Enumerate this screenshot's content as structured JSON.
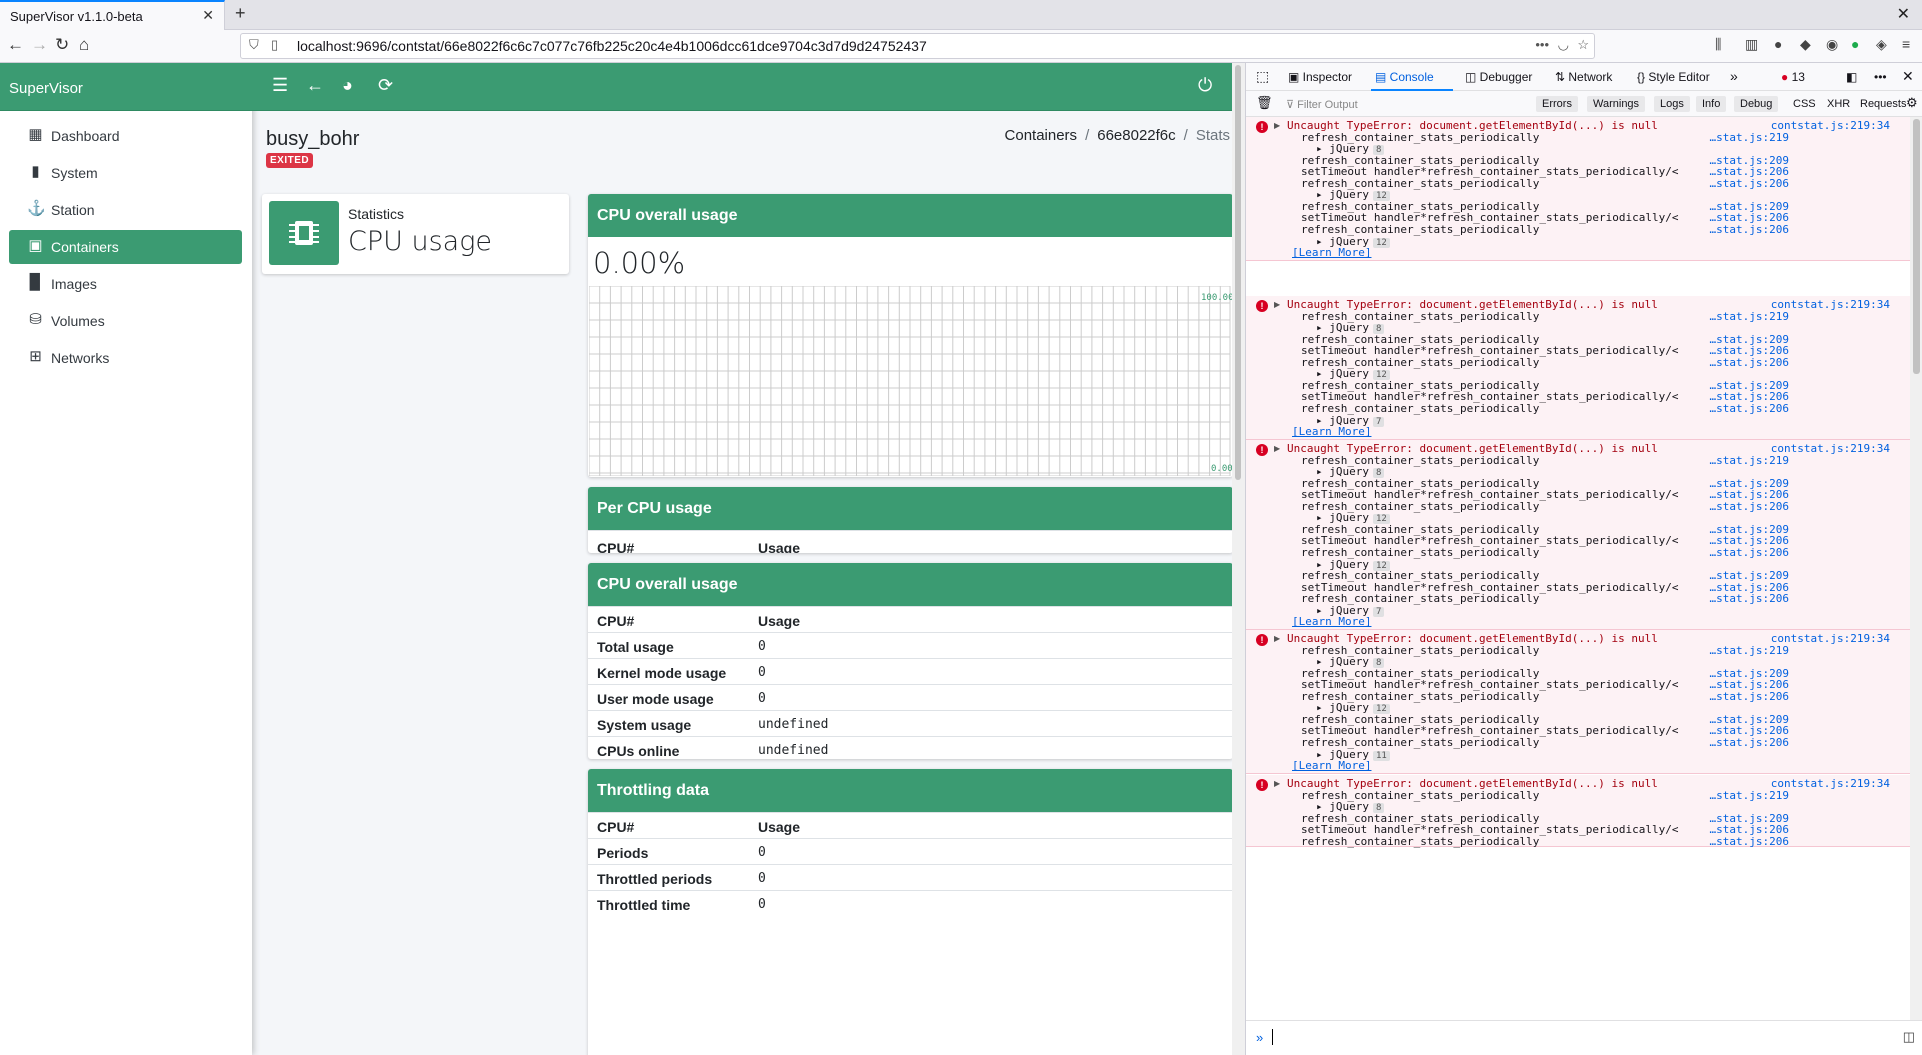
{
  "browser": {
    "tab_title": "SuperVisor v1.1.0-beta",
    "url": "localhost:9696/contstat/66e8022f6c6c7c077c76fb225c20c4e4b1006dcc61dce9704c3d7d9d24752437"
  },
  "app": {
    "brand": "SuperVisor",
    "sidebar": {
      "items": [
        {
          "label": "Dashboard",
          "icon": "dashboard-icon"
        },
        {
          "label": "System",
          "icon": "memory-chip-icon"
        },
        {
          "label": "Station",
          "icon": "anchor-icon"
        },
        {
          "label": "Containers",
          "icon": "boxes-icon",
          "active": true
        },
        {
          "label": "Images",
          "icon": "file-icon"
        },
        {
          "label": "Volumes",
          "icon": "database-icon"
        },
        {
          "label": "Networks",
          "icon": "network-icon"
        }
      ]
    },
    "header": {
      "container_name": "busy_bohr",
      "status_badge": "EXITED",
      "breadcrumb": [
        "Containers",
        "66e8022f6c",
        "Stats"
      ]
    },
    "info_box": {
      "title": "Statistics",
      "value": "CPU usage"
    },
    "cpu_overall": {
      "title": "CPU overall usage",
      "value": "0.00%",
      "chart_max_label": "100.00",
      "chart_min_label": "0.00"
    },
    "per_cpu": {
      "title": "Per CPU usage",
      "columns": [
        "CPU#",
        "Usage"
      ]
    },
    "cpu_overall_table": {
      "title": "CPU overall usage",
      "columns": [
        "CPU#",
        "Usage"
      ],
      "rows": [
        {
          "key": "Total usage",
          "value": "0"
        },
        {
          "key": "Kernel mode usage",
          "value": "0"
        },
        {
          "key": "User mode usage",
          "value": "0"
        },
        {
          "key": "System usage",
          "value": "undefined"
        },
        {
          "key": "CPUs online",
          "value": "undefined"
        }
      ]
    },
    "throttling": {
      "title": "Throttling data",
      "columns": [
        "CPU#",
        "Usage"
      ],
      "rows": [
        {
          "key": "Periods",
          "value": "0"
        },
        {
          "key": "Throttled periods",
          "value": "0"
        },
        {
          "key": "Throttled time",
          "value": "0"
        }
      ]
    },
    "colors": {
      "primary": "#3b9b72",
      "danger": "#dc3545"
    }
  },
  "devtools": {
    "tabs": [
      "Inspector",
      "Console",
      "Debugger",
      "Network",
      "Style Editor"
    ],
    "selected_tab": "Console",
    "error_count": "13",
    "filter_placeholder": "Filter Output",
    "filter_buttons": [
      "Errors",
      "Warnings",
      "Logs",
      "Info",
      "Debug"
    ],
    "filter_plain": [
      "CSS",
      "XHR",
      "Requests"
    ],
    "error_text": "Uncaught TypeError: document.getElementById(...) is null",
    "error_source": "contstat.js:219:34",
    "fn_refresh": "refresh_container_stats_periodically",
    "fn_settimeout": "setTimeout handler*refresh_container_stats_periodically/<",
    "jquery_label": "jQuery",
    "src_219": "…stat.js:219",
    "src_209": "…stat.js:209",
    "src_206": "…stat.js:206",
    "learn_more": "[Learn More]",
    "jq_counts": [
      [
        "8",
        "12",
        "12"
      ],
      [
        "8",
        "12",
        "7"
      ],
      [
        "8",
        "12",
        "12",
        "7"
      ],
      [
        "8",
        "12",
        "11"
      ],
      [
        "8"
      ]
    ]
  }
}
